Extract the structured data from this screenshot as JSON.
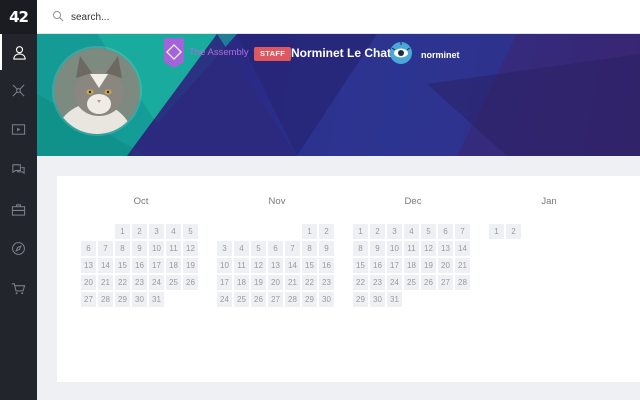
{
  "app": {
    "logo": "42"
  },
  "sidebar": {
    "items": [
      {
        "name": "sidebar-item-profile",
        "icon": "user-icon"
      },
      {
        "name": "sidebar-item-projects",
        "icon": "network-icon"
      },
      {
        "name": "sidebar-item-elearning",
        "icon": "video-icon"
      },
      {
        "name": "sidebar-item-forum",
        "icon": "chat-icon"
      },
      {
        "name": "sidebar-item-companies",
        "icon": "briefcase-icon"
      },
      {
        "name": "sidebar-item-events",
        "icon": "compass-icon"
      },
      {
        "name": "sidebar-item-shop",
        "icon": "cart-icon"
      }
    ]
  },
  "search": {
    "placeholder": "search..."
  },
  "profile": {
    "coalition": "The Assembly",
    "badge": "STAFF",
    "display_name": "Norminet Le Chat",
    "login": "norminet",
    "colors": {
      "coalition": "#b26be0",
      "badge": "#e0575f"
    }
  },
  "calendar": {
    "months": [
      {
        "label": "Oct",
        "first_col": 2,
        "days": 31
      },
      {
        "label": "Nov",
        "first_col": 5,
        "days": 30
      },
      {
        "label": "Dec",
        "first_col": 0,
        "days": 31
      },
      {
        "label": "Jan",
        "first_col": 0,
        "days": 2
      }
    ]
  }
}
